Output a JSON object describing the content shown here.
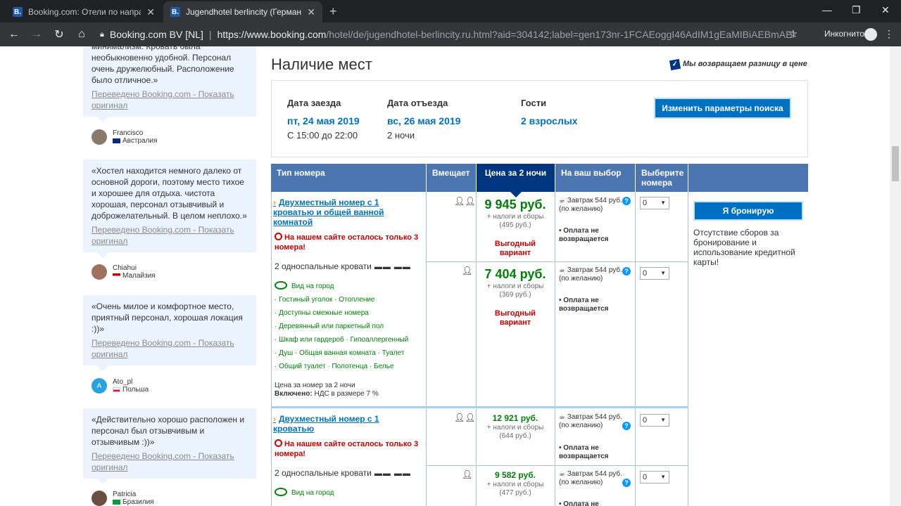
{
  "browser": {
    "tabs": [
      {
        "label": "Booking.com: Отели по направле",
        "active": false
      },
      {
        "label": "Jugendhotel berlincity (Германия",
        "active": true
      }
    ],
    "favicon_letter": "B.",
    "org": "Booking.com BV [NL]",
    "url_host": "https://www.booking.com",
    "url_path": "/hotel/de/jugendhotel-berlincity.ru.html?aid=304142;label=gen173nr-1FCAEoggI46AdIM1gEaMIBiAEBmAEhuA...",
    "incognito_label": "Инкогнито"
  },
  "reviews": [
    {
      "text": "минимализм. Кровать была необыкновенно удобной. Персонал очень дружелюбный. Расположение было отличное.»",
      "translated": "Переведено Booking.com - Показать оригинал",
      "name": "Francisco",
      "country": "Австралия"
    },
    {
      "text": "«Хостел находится немного далеко от основной дороги, поэтому место тихое и хорошее для отдыха. чистота хорошая, персонал отзывчивый и доброжелательный. В целом неплохо.»",
      "translated": "Переведено Booking.com - Показать оригинал",
      "name": "Chiahui",
      "country": "Малайзия"
    },
    {
      "text": "«Очень милое и комфортное место, приятный персонал, хорошая локация :))»",
      "translated": "Переведено Booking.com - Показать оригинал",
      "name": "Ato_pl",
      "country": "Польша",
      "avatar_letter": "A"
    },
    {
      "text": "«Действительно хорошо расположен и персонал был отзывчивым и отзывчивым :))»",
      "translated": "Переведено Booking.com - Показать оригинал",
      "name": "Patricia",
      "country": "Бразилия"
    }
  ],
  "main": {
    "title": "Наличие мест",
    "price_match": "Мы возвращаем разницу в цене",
    "checkin_label": "Дата заезда",
    "checkin_value": "пт, 24 мая 2019",
    "checkin_sub": "С 15:00 до 22:00",
    "checkout_label": "Дата отъезда",
    "checkout_value": "вс, 26 мая 2019",
    "checkout_sub": "2 ночи",
    "guests_label": "Гости",
    "guests_value": "2 взрослых",
    "change_button": "Изменить параметры поиска"
  },
  "table": {
    "headers": [
      "Тип номера",
      "Вмещает",
      "Цена за 2 ночи",
      "На ваш выбор",
      "Выберите номера"
    ],
    "book_button": "Я бронирую",
    "no_fees": "Отсутствие сборов за бронирование и использование кредитной карты!",
    "rooms": [
      {
        "name": "Двухместный номер с 1 кроватью и общей ванной комнатой",
        "warning": "На нашем сайте осталось только 3 номера!",
        "beds": "2 односпальные кровати",
        "facilities": [
          "Вид на город",
          "· Гостиный уголок  · Отопление",
          "· Доступны смежные номера",
          "· Деревянный или паркетный пол",
          "· Шкаф или гардероб  · Гипоаллергенный",
          "· Душ  · Общая ванная комната  · Туалет",
          "· Общий туалет  · Полотенца  · Белье"
        ],
        "price_note": "Цена за номер за 2 ночи",
        "included_label": "Включено:",
        "included_value": "НДС в размере 7 %",
        "options": [
          {
            "price": "9 945 руб.",
            "fees": "+ налоги и сборы",
            "fees_value": "(495 руб.)",
            "deal": "Выгодный вариант",
            "breakfast": "Завтрак 544 руб. (по желанию)",
            "cancel": "Оплата не возвращается",
            "qty": "0"
          },
          {
            "price": "7 404 руб.",
            "fees": "+ налоги и сборы",
            "fees_value": "(369 руб.)",
            "deal": "Выгодный вариант",
            "breakfast": "Завтрак 544 руб. (по желанию)",
            "cancel": "Оплата не возвращается",
            "qty": "0"
          }
        ]
      },
      {
        "name": "Двухместный номер с 1 кроватью",
        "warning": "На нашем сайте осталось только 3 номера!",
        "beds": "2 односпальные кровати",
        "facilities": [
          "Вид на город"
        ],
        "options": [
          {
            "price": "12 921 руб.",
            "fees": "+ налоги и сборы",
            "fees_value": "(644 руб.)",
            "breakfast": "Завтрак 544 руб. (по желанию)",
            "cancel": "Оплата не возвращается",
            "qty": "0"
          },
          {
            "price": "9 582 руб.",
            "fees": "+ налоги и сборы",
            "fees_value": "(477 руб.)",
            "breakfast": "Завтрак 544 руб. (по желанию)",
            "cancel": "Оплата не",
            "qty": "0"
          }
        ]
      }
    ]
  },
  "colors": {
    "brand_blue": "#003580",
    "link_blue": "#0071c2",
    "header_blue": "#4b76b2",
    "green_price": "#008009",
    "warning_red": "#cc0000"
  }
}
